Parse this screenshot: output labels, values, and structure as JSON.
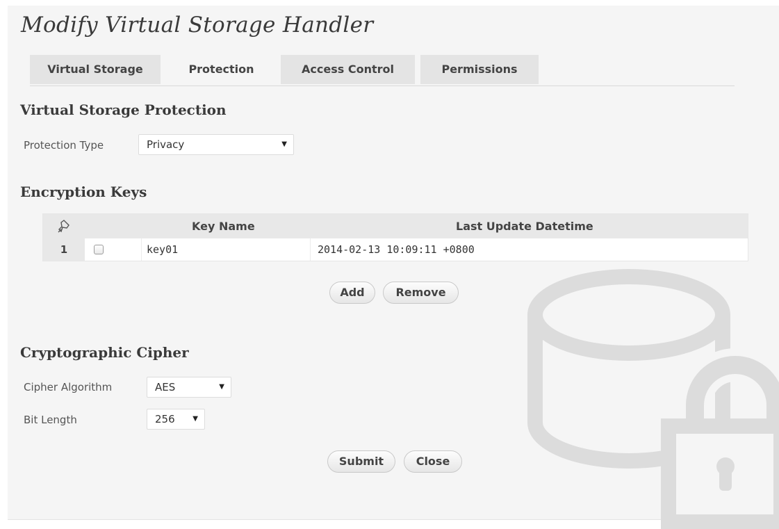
{
  "dialog": {
    "title": "Modify Virtual Storage Handler"
  },
  "tabs": [
    {
      "label": "Virtual Storage"
    },
    {
      "label": "Protection",
      "active": true
    },
    {
      "label": "Access Control"
    },
    {
      "label": "Permissions"
    }
  ],
  "protection": {
    "heading": "Virtual Storage Protection",
    "type_label": "Protection Type",
    "type_value": "Privacy"
  },
  "keys": {
    "heading": "Encryption Keys",
    "columns": {
      "key_name": "Key Name",
      "last_update": "Last Update Datetime"
    },
    "rows": [
      {
        "num": "1",
        "checked": false,
        "key_name": "key01",
        "last_update": "2014-02-13 10:09:11 +0800"
      }
    ],
    "add_label": "Add",
    "remove_label": "Remove"
  },
  "cipher": {
    "heading": "Cryptographic Cipher",
    "algorithm_label": "Cipher Algorithm",
    "algorithm_value": "AES",
    "bits_label": "Bit Length",
    "bits_value": "256"
  },
  "actions": {
    "submit_label": "Submit",
    "close_label": "Close"
  },
  "icons": {
    "select_arrow": "▼",
    "watermark": "database-lock-icon",
    "header_icon": "pin-icon"
  },
  "colors": {
    "panel_bg": "#f5f5f5",
    "tab_bg": "#e4e4e4",
    "header_bg": "#e8e8e8",
    "watermark": "#dcdcdc"
  }
}
